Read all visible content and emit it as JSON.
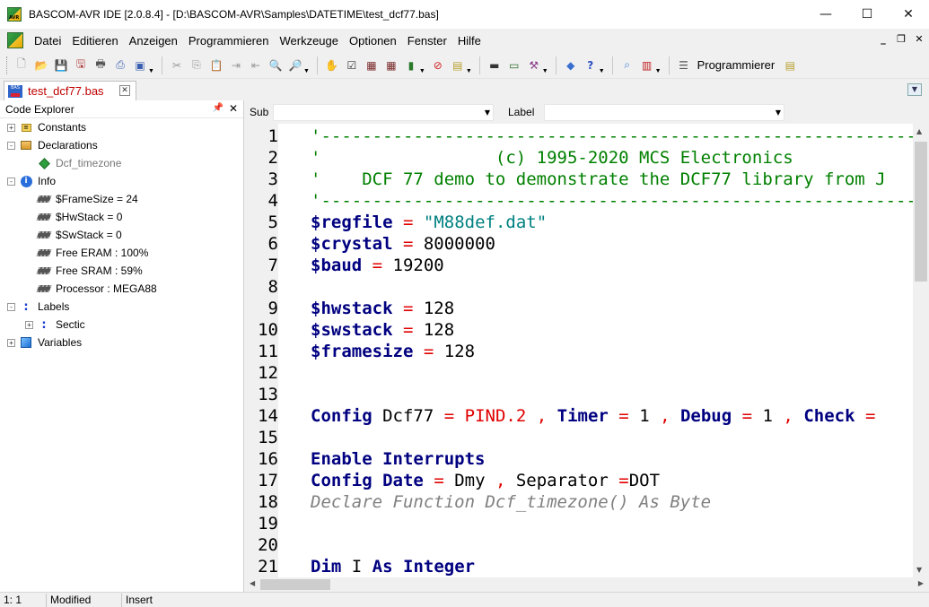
{
  "window": {
    "title": "BASCOM-AVR IDE [2.0.8.4] - [D:\\BASCOM-AVR\\Samples\\DATETIME\\test_dcf77.bas]",
    "minimize": "—",
    "maximize": "☐",
    "close": "✕"
  },
  "menu": {
    "items": [
      "Datei",
      "Editieren",
      "Anzeigen",
      "Programmieren",
      "Werkzeuge",
      "Optionen",
      "Fenster",
      "Hilfe"
    ],
    "mdi_min": "_",
    "mdi_restore": "❐",
    "mdi_close": "✕"
  },
  "toolbar": {
    "program_label": "Programmierer"
  },
  "tab": {
    "filename": "test_dcf77.bas",
    "close": "✕"
  },
  "explorer": {
    "title": "Code Explorer",
    "nodes": [
      {
        "label": "Constants",
        "icon": "constants-icon",
        "level": 0,
        "expander": "+"
      },
      {
        "label": "Declarations",
        "icon": "declarations-icon",
        "level": 0,
        "expander": "-"
      },
      {
        "label": "Dcf_timezone",
        "icon": "function-icon",
        "level": 1,
        "expander": ""
      },
      {
        "label": "Info",
        "icon": "info-icon",
        "level": 0,
        "expander": "-"
      },
      {
        "label": "$FrameSize = 24",
        "icon": "chip-icon",
        "level": 1,
        "expander": ""
      },
      {
        "label": "$HwStack  = 0",
        "icon": "chip-icon",
        "level": 1,
        "expander": ""
      },
      {
        "label": "$SwStack  = 0",
        "icon": "chip-icon",
        "level": 1,
        "expander": ""
      },
      {
        "label": "Free ERAM : 100%",
        "icon": "chip-icon",
        "level": 1,
        "expander": ""
      },
      {
        "label": "Free SRAM : 59%",
        "icon": "chip-icon",
        "level": 1,
        "expander": ""
      },
      {
        "label": "Processor : MEGA88",
        "icon": "chip-icon",
        "level": 1,
        "expander": ""
      },
      {
        "label": "Labels",
        "icon": "label-icon",
        "level": 0,
        "expander": "-"
      },
      {
        "label": "Sectic",
        "icon": "label-icon",
        "level": 1,
        "expander": "+"
      },
      {
        "label": "Variables",
        "icon": "variables-icon",
        "level": 0,
        "expander": "+"
      }
    ]
  },
  "subbar": {
    "sub_label": "Sub",
    "sub_value": "",
    "label_label": "Label",
    "label_value": ""
  },
  "code": {
    "lines": [
      "'--------------------------------------------------------------------------------",
      "'                 (c) 1995-2020 MCS Electronics",
      "'    DCF 77 demo to demonstrate the DCF77 library from J",
      "'--------------------------------------------------------------------------------",
      "$regfile = \"M88def.dat\"",
      "$crystal = 8000000",
      "$baud = 19200",
      "",
      "$hwstack = 128",
      "$swstack = 128",
      "$framesize = 128",
      "",
      "",
      "Config Dcf77 = PIND.2 , Timer = 1 , Debug = 1 , Check =",
      "",
      "Enable Interrupts",
      "Config Date = Dmy , Separator =DOT",
      "Declare Function Dcf_timezone() As Byte",
      "",
      "",
      "Dim I As Integer"
    ]
  },
  "status": {
    "position": "1: 1",
    "modified": "Modified",
    "mode": "Insert"
  },
  "colors": {
    "comment": "#008000",
    "keyword": "#000080",
    "operator": "#e00000",
    "string": "#008080",
    "tab_name": "#c00000"
  }
}
